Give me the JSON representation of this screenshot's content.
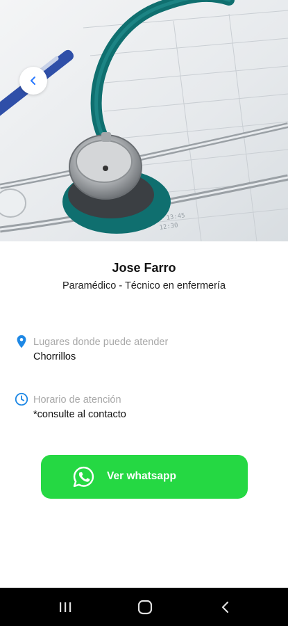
{
  "hero": {
    "image": "stethoscope-photo"
  },
  "back_button": {
    "icon": "chevron-left-icon",
    "color": "#2979ff"
  },
  "profile": {
    "name": "Jose Farro",
    "role": "Paramédico - Técnico en enfermería"
  },
  "locations": {
    "icon": "location-pin-icon",
    "label": "Lugares donde puede atender",
    "value": "Chorrillos"
  },
  "schedule": {
    "icon": "clock-icon",
    "label": "Horario de atención",
    "value": "*consulte al contacto"
  },
  "whatsapp_button": {
    "icon": "whatsapp-icon",
    "label": "Ver whatsapp",
    "color": "#25d843"
  },
  "system_nav": {
    "recents": "recents-icon",
    "home": "home-icon",
    "back": "back-icon"
  },
  "colors": {
    "accent": "#1e88e5",
    "muted_label": "#a8a8a8"
  }
}
